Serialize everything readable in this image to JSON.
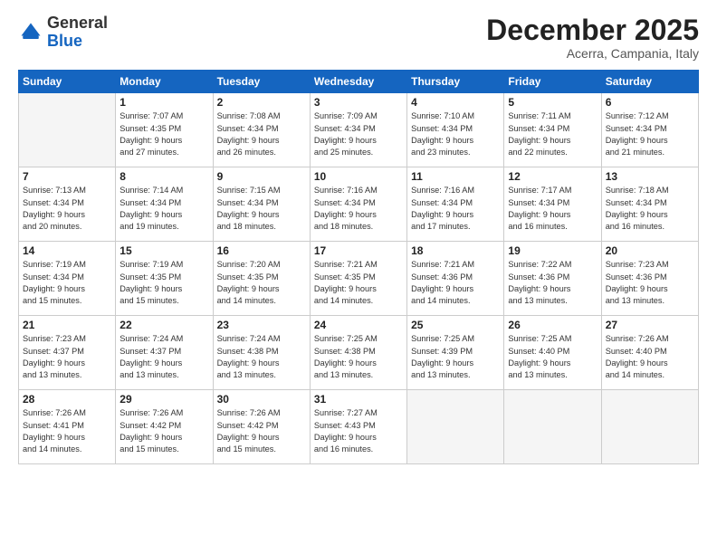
{
  "header": {
    "logo_general": "General",
    "logo_blue": "Blue",
    "title": "December 2025",
    "location": "Acerra, Campania, Italy"
  },
  "days_of_week": [
    "Sunday",
    "Monday",
    "Tuesday",
    "Wednesday",
    "Thursday",
    "Friday",
    "Saturday"
  ],
  "weeks": [
    [
      {
        "day": "",
        "sunrise": "",
        "sunset": "",
        "daylight": ""
      },
      {
        "day": "1",
        "sunrise": "7:07 AM",
        "sunset": "4:35 PM",
        "daylight": "9 hours and 27 minutes."
      },
      {
        "day": "2",
        "sunrise": "7:08 AM",
        "sunset": "4:34 PM",
        "daylight": "9 hours and 26 minutes."
      },
      {
        "day": "3",
        "sunrise": "7:09 AM",
        "sunset": "4:34 PM",
        "daylight": "9 hours and 25 minutes."
      },
      {
        "day": "4",
        "sunrise": "7:10 AM",
        "sunset": "4:34 PM",
        "daylight": "9 hours and 23 minutes."
      },
      {
        "day": "5",
        "sunrise": "7:11 AM",
        "sunset": "4:34 PM",
        "daylight": "9 hours and 22 minutes."
      },
      {
        "day": "6",
        "sunrise": "7:12 AM",
        "sunset": "4:34 PM",
        "daylight": "9 hours and 21 minutes."
      }
    ],
    [
      {
        "day": "7",
        "sunrise": "7:13 AM",
        "sunset": "4:34 PM",
        "daylight": "9 hours and 20 minutes."
      },
      {
        "day": "8",
        "sunrise": "7:14 AM",
        "sunset": "4:34 PM",
        "daylight": "9 hours and 19 minutes."
      },
      {
        "day": "9",
        "sunrise": "7:15 AM",
        "sunset": "4:34 PM",
        "daylight": "9 hours and 18 minutes."
      },
      {
        "day": "10",
        "sunrise": "7:16 AM",
        "sunset": "4:34 PM",
        "daylight": "9 hours and 18 minutes."
      },
      {
        "day": "11",
        "sunrise": "7:16 AM",
        "sunset": "4:34 PM",
        "daylight": "9 hours and 17 minutes."
      },
      {
        "day": "12",
        "sunrise": "7:17 AM",
        "sunset": "4:34 PM",
        "daylight": "9 hours and 16 minutes."
      },
      {
        "day": "13",
        "sunrise": "7:18 AM",
        "sunset": "4:34 PM",
        "daylight": "9 hours and 16 minutes."
      }
    ],
    [
      {
        "day": "14",
        "sunrise": "7:19 AM",
        "sunset": "4:34 PM",
        "daylight": "9 hours and 15 minutes."
      },
      {
        "day": "15",
        "sunrise": "7:19 AM",
        "sunset": "4:35 PM",
        "daylight": "9 hours and 15 minutes."
      },
      {
        "day": "16",
        "sunrise": "7:20 AM",
        "sunset": "4:35 PM",
        "daylight": "9 hours and 14 minutes."
      },
      {
        "day": "17",
        "sunrise": "7:21 AM",
        "sunset": "4:35 PM",
        "daylight": "9 hours and 14 minutes."
      },
      {
        "day": "18",
        "sunrise": "7:21 AM",
        "sunset": "4:36 PM",
        "daylight": "9 hours and 14 minutes."
      },
      {
        "day": "19",
        "sunrise": "7:22 AM",
        "sunset": "4:36 PM",
        "daylight": "9 hours and 13 minutes."
      },
      {
        "day": "20",
        "sunrise": "7:23 AM",
        "sunset": "4:36 PM",
        "daylight": "9 hours and 13 minutes."
      }
    ],
    [
      {
        "day": "21",
        "sunrise": "7:23 AM",
        "sunset": "4:37 PM",
        "daylight": "9 hours and 13 minutes."
      },
      {
        "day": "22",
        "sunrise": "7:24 AM",
        "sunset": "4:37 PM",
        "daylight": "9 hours and 13 minutes."
      },
      {
        "day": "23",
        "sunrise": "7:24 AM",
        "sunset": "4:38 PM",
        "daylight": "9 hours and 13 minutes."
      },
      {
        "day": "24",
        "sunrise": "7:25 AM",
        "sunset": "4:38 PM",
        "daylight": "9 hours and 13 minutes."
      },
      {
        "day": "25",
        "sunrise": "7:25 AM",
        "sunset": "4:39 PM",
        "daylight": "9 hours and 13 minutes."
      },
      {
        "day": "26",
        "sunrise": "7:25 AM",
        "sunset": "4:40 PM",
        "daylight": "9 hours and 13 minutes."
      },
      {
        "day": "27",
        "sunrise": "7:26 AM",
        "sunset": "4:40 PM",
        "daylight": "9 hours and 14 minutes."
      }
    ],
    [
      {
        "day": "28",
        "sunrise": "7:26 AM",
        "sunset": "4:41 PM",
        "daylight": "9 hours and 14 minutes."
      },
      {
        "day": "29",
        "sunrise": "7:26 AM",
        "sunset": "4:42 PM",
        "daylight": "9 hours and 15 minutes."
      },
      {
        "day": "30",
        "sunrise": "7:26 AM",
        "sunset": "4:42 PM",
        "daylight": "9 hours and 15 minutes."
      },
      {
        "day": "31",
        "sunrise": "7:27 AM",
        "sunset": "4:43 PM",
        "daylight": "9 hours and 16 minutes."
      },
      {
        "day": "",
        "sunrise": "",
        "sunset": "",
        "daylight": ""
      },
      {
        "day": "",
        "sunrise": "",
        "sunset": "",
        "daylight": ""
      },
      {
        "day": "",
        "sunrise": "",
        "sunset": "",
        "daylight": ""
      }
    ]
  ],
  "labels": {
    "sunrise": "Sunrise:",
    "sunset": "Sunset:",
    "daylight": "Daylight:"
  }
}
